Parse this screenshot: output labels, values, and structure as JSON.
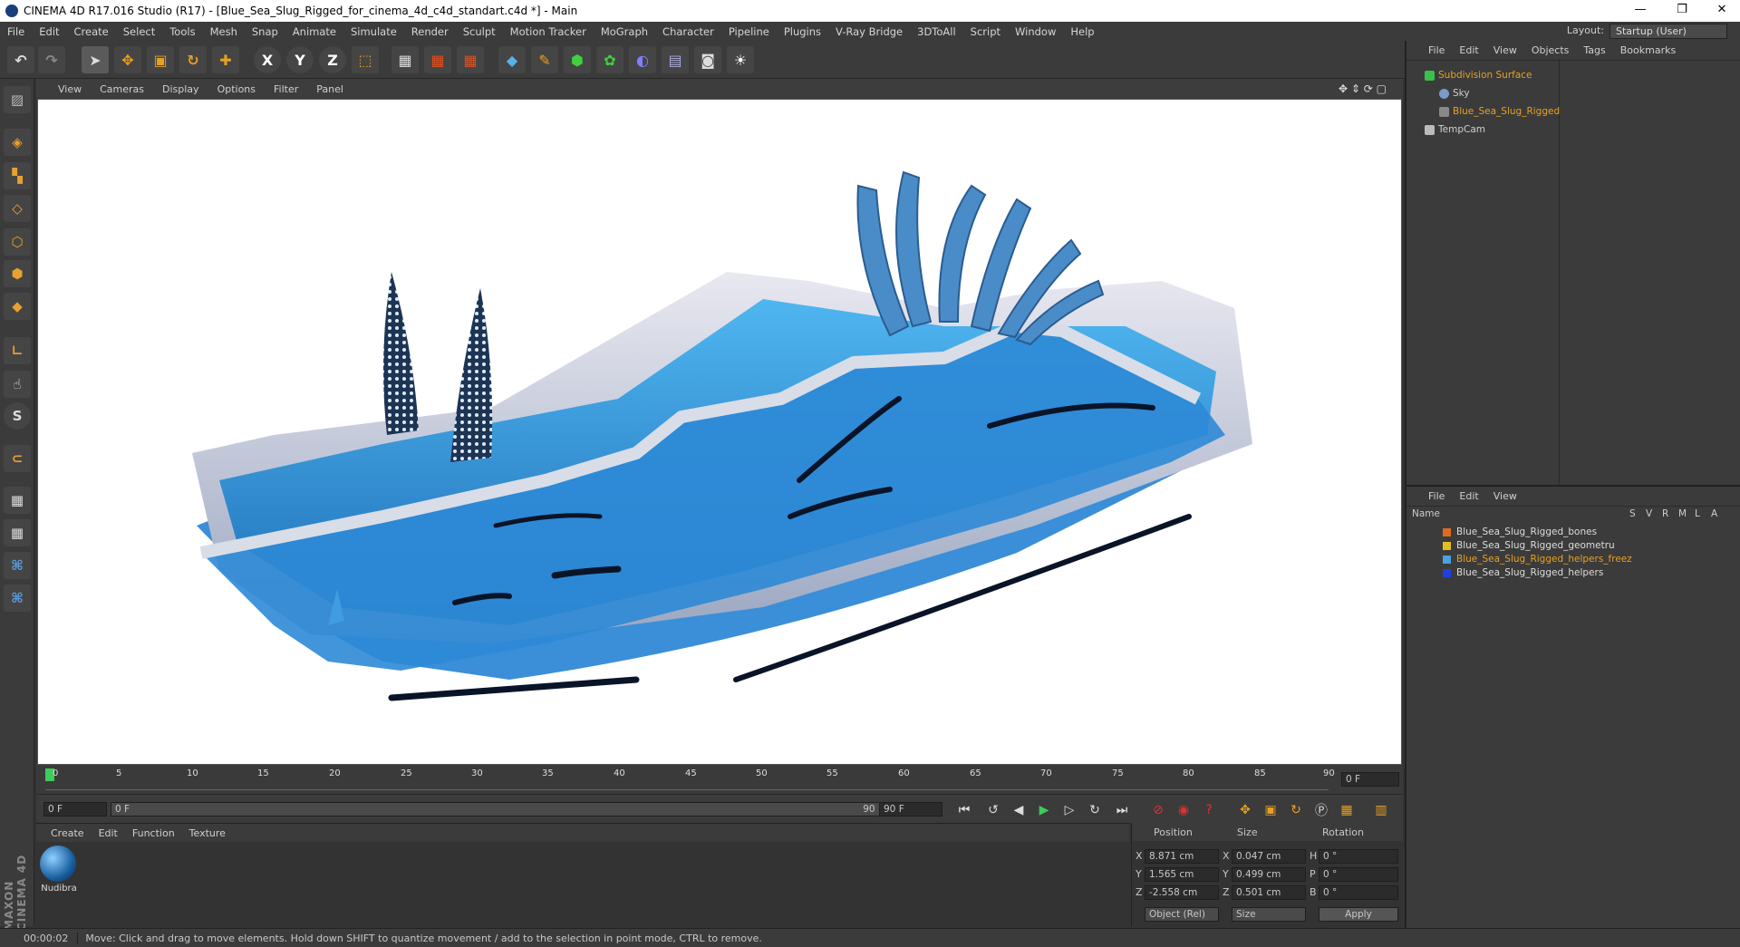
{
  "window": {
    "title": "CINEMA 4D R17.016 Studio (R17) - [Blue_Sea_Slug_Rigged_for_cinema_4d_c4d_standart.c4d *] - Main",
    "controls": [
      "—",
      "❐",
      "✕"
    ]
  },
  "menubar": {
    "items": [
      "File",
      "Edit",
      "Create",
      "Select",
      "Tools",
      "Mesh",
      "Snap",
      "Animate",
      "Simulate",
      "Render",
      "Sculpt",
      "Motion Tracker",
      "MoGraph",
      "Character",
      "Pipeline",
      "Plugins",
      "V-Ray Bridge",
      "3DToAll",
      "Script",
      "Window",
      "Help"
    ],
    "layout_label": "Layout:",
    "layout_value": "Startup (User)"
  },
  "viewport_menu": [
    "View",
    "Cameras",
    "Display",
    "Options",
    "Filter",
    "Panel"
  ],
  "object_manager": {
    "menu": [
      "File",
      "Edit",
      "View",
      "Objects",
      "Tags",
      "Bookmarks"
    ],
    "objects": [
      {
        "name": "Subdivision Surface",
        "color": "#e8a020"
      },
      {
        "name": "Sky",
        "color": "#d0d0d0"
      },
      {
        "name": "Blue_Sea_Slug_Rigged",
        "color": "#e8a020"
      },
      {
        "name": "TempCam",
        "color": "#d0d0d0"
      }
    ]
  },
  "layer_manager": {
    "menu": [
      "File",
      "Edit",
      "View"
    ],
    "columns": [
      "Name",
      "S",
      "V",
      "R",
      "M",
      "L",
      "A"
    ],
    "layers": [
      {
        "name": "Blue_Sea_Slug_Rigged_bones",
        "swatch": "#e06b1e",
        "text_color": "#d8d8d8"
      },
      {
        "name": "Blue_Sea_Slug_Rigged_geometru",
        "swatch": "#e0c020",
        "text_color": "#d8d8d8"
      },
      {
        "name": "Blue_Sea_Slug_Rigged_helpers_freez",
        "swatch": "#4aa0e0",
        "text_color": "#e8a020"
      },
      {
        "name": "Blue_Sea_Slug_Rigged_helpers",
        "swatch": "#2040e0",
        "text_color": "#d8d8d8"
      }
    ]
  },
  "timeline": {
    "ticks": [
      "0",
      "5",
      "10",
      "15",
      "20",
      "25",
      "30",
      "35",
      "40",
      "45",
      "50",
      "55",
      "60",
      "65",
      "70",
      "75",
      "80",
      "85",
      "90"
    ],
    "current_frame": "0 F",
    "start_field": "0 F",
    "range_start": "0 F",
    "range_end": "90 F",
    "end_field": "90 F"
  },
  "material_manager": {
    "menu": [
      "Create",
      "Edit",
      "Function",
      "Texture"
    ],
    "materials": [
      {
        "name": "Nudibra"
      }
    ]
  },
  "attributes": {
    "headers": [
      "Position",
      "Size",
      "Rotation"
    ],
    "rows": [
      {
        "axis": "X",
        "pos": "8.871 cm",
        "size_axis": "X",
        "size": "0.047 cm",
        "rot_axis": "H",
        "rot": "0 °"
      },
      {
        "axis": "Y",
        "pos": "1.565 cm",
        "size_axis": "Y",
        "size": "0.499 cm",
        "rot_axis": "P",
        "rot": "0 °"
      },
      {
        "axis": "Z",
        "pos": "-2.558 cm",
        "size_axis": "Z",
        "size": "0.501 cm",
        "rot_axis": "B",
        "rot": "0 °"
      }
    ],
    "coord_mode": "Object (Rel)",
    "size_mode": "Size",
    "apply_label": "Apply"
  },
  "status": {
    "time": "00:00:02",
    "message": "Move: Click and drag to move elements. Hold down SHIFT to quantize movement / add to the selection in point mode, CTRL to remove."
  },
  "brand": {
    "vertical_text": "MAXON CINEMA 4D"
  },
  "colors": {
    "accent": "#e8a020",
    "slug_blue": "#2a8fd6",
    "viewport_bg": "#ffffff"
  }
}
